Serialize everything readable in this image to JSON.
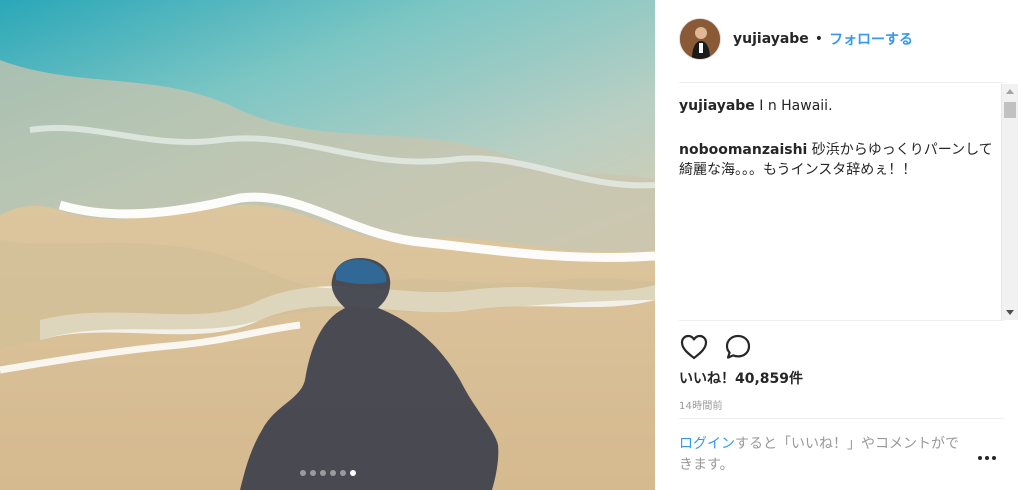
{
  "post": {
    "username": "yujiayabe",
    "separator": "•",
    "follow_label": "フォローする",
    "image": {
      "subject": "shadow of person on beach shoreline",
      "carousel": {
        "count": 6,
        "active_index": 5
      }
    }
  },
  "comments": [
    {
      "user": "yujiayabe",
      "text": "I n Hawaii."
    },
    {
      "user": "noboomanzaishi",
      "text": "砂浜からゆっくりパーンして綺麗な海。。。もうインスタ辞めぇ！！"
    }
  ],
  "actions": {
    "like_icon": "heart-icon",
    "comment_icon": "comment-icon"
  },
  "likes": "いいね！40,859件",
  "timestamp": "14時間前",
  "login_prompt": {
    "link": "ログイン",
    "text": "すると「いいね！」やコメントができます。"
  },
  "colors": {
    "accent": "#3897f0",
    "text": "#262626",
    "muted": "#999999"
  }
}
